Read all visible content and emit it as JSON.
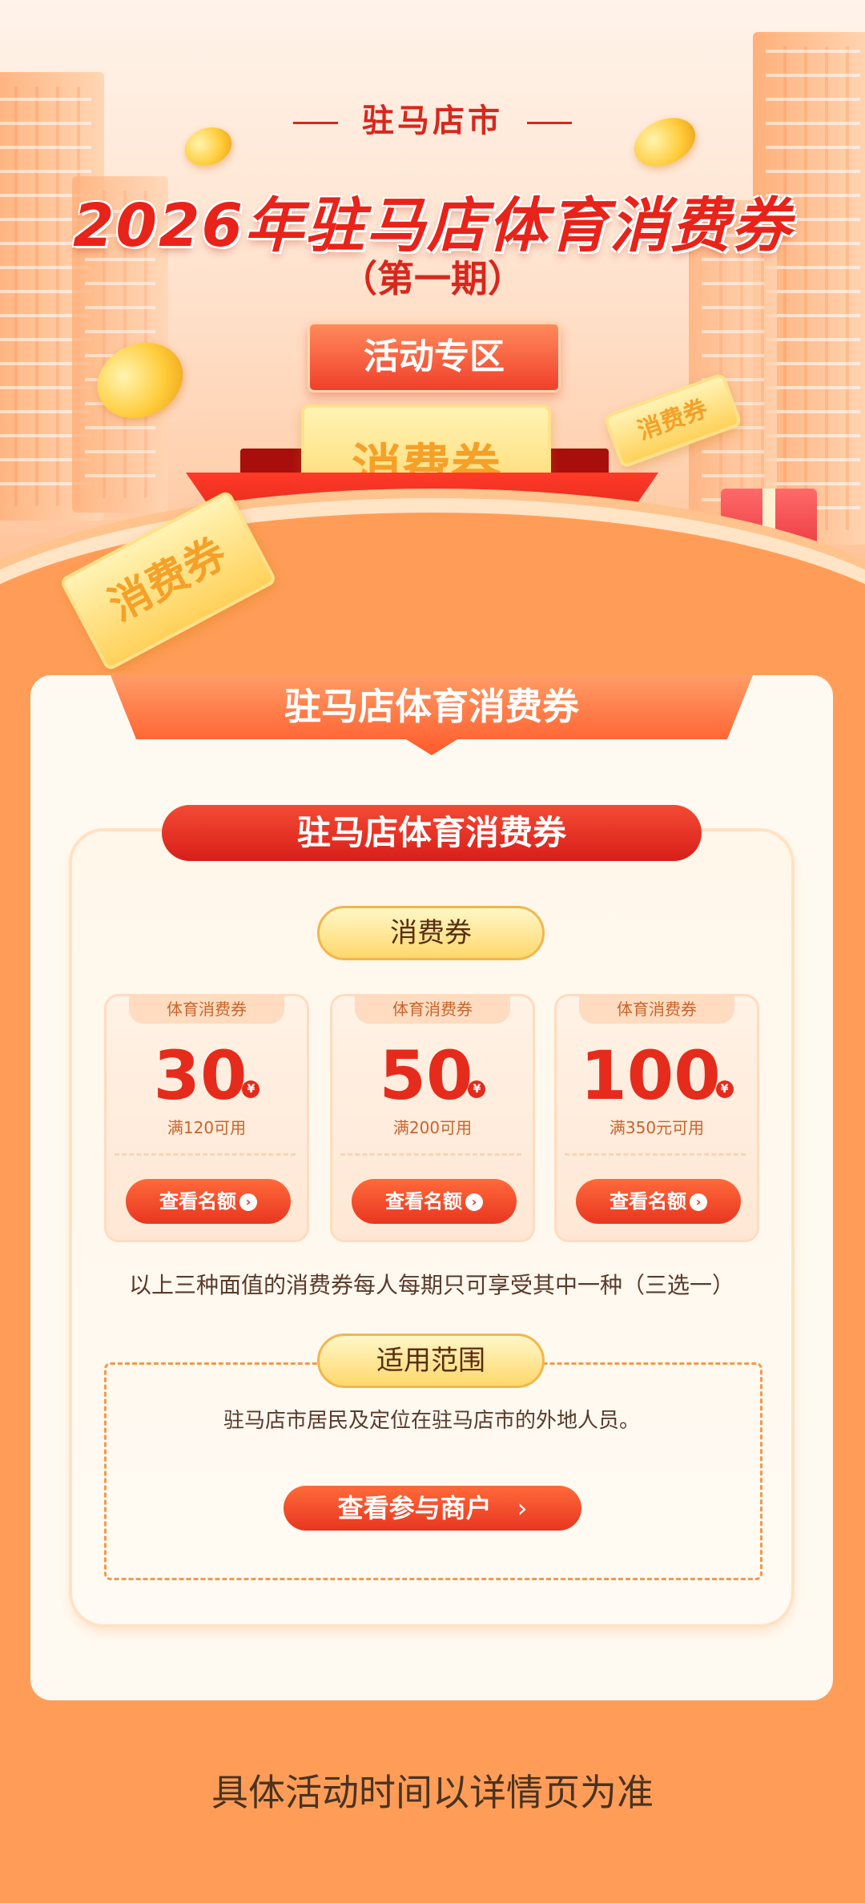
{
  "hero": {
    "city": "驻马店市",
    "title": "2026年驻马店体育消费券",
    "issue": "（第一期）",
    "zone_button": "活动专区",
    "ticket_main": "消费券",
    "ticket_side1": "消费券",
    "ticket_side2": "消费券"
  },
  "card": {
    "banner": "驻马店体育消费券",
    "section_title": "驻马店体育消费券",
    "coupon_label": "消费券",
    "coupons": [
      {
        "tag": "体育消费券",
        "amount": "30",
        "currency": "¥",
        "condition": "满120可用",
        "button": "查看名额"
      },
      {
        "tag": "体育消费券",
        "amount": "50",
        "currency": "¥",
        "condition": "满200可用",
        "button": "查看名额"
      },
      {
        "tag": "体育消费券",
        "amount": "100",
        "currency": "¥",
        "condition": "满350元可用",
        "button": "查看名额"
      }
    ],
    "note": "以上三种面值的消费券每人每期只可享受其中一种（三选一）",
    "scope_label": "适用范围",
    "scope_text": "驻马店市居民及定位在驻马店市的外地人员。",
    "merchant_button": "查看参与商户"
  },
  "footer": {
    "note": "具体活动时间以详情页为准"
  },
  "icons": {
    "arrow": "chevron-right-icon"
  },
  "colors": {
    "page_bg": "#ff9d58",
    "accent_red": "#e52b1c",
    "gold": "#ffd86b"
  }
}
